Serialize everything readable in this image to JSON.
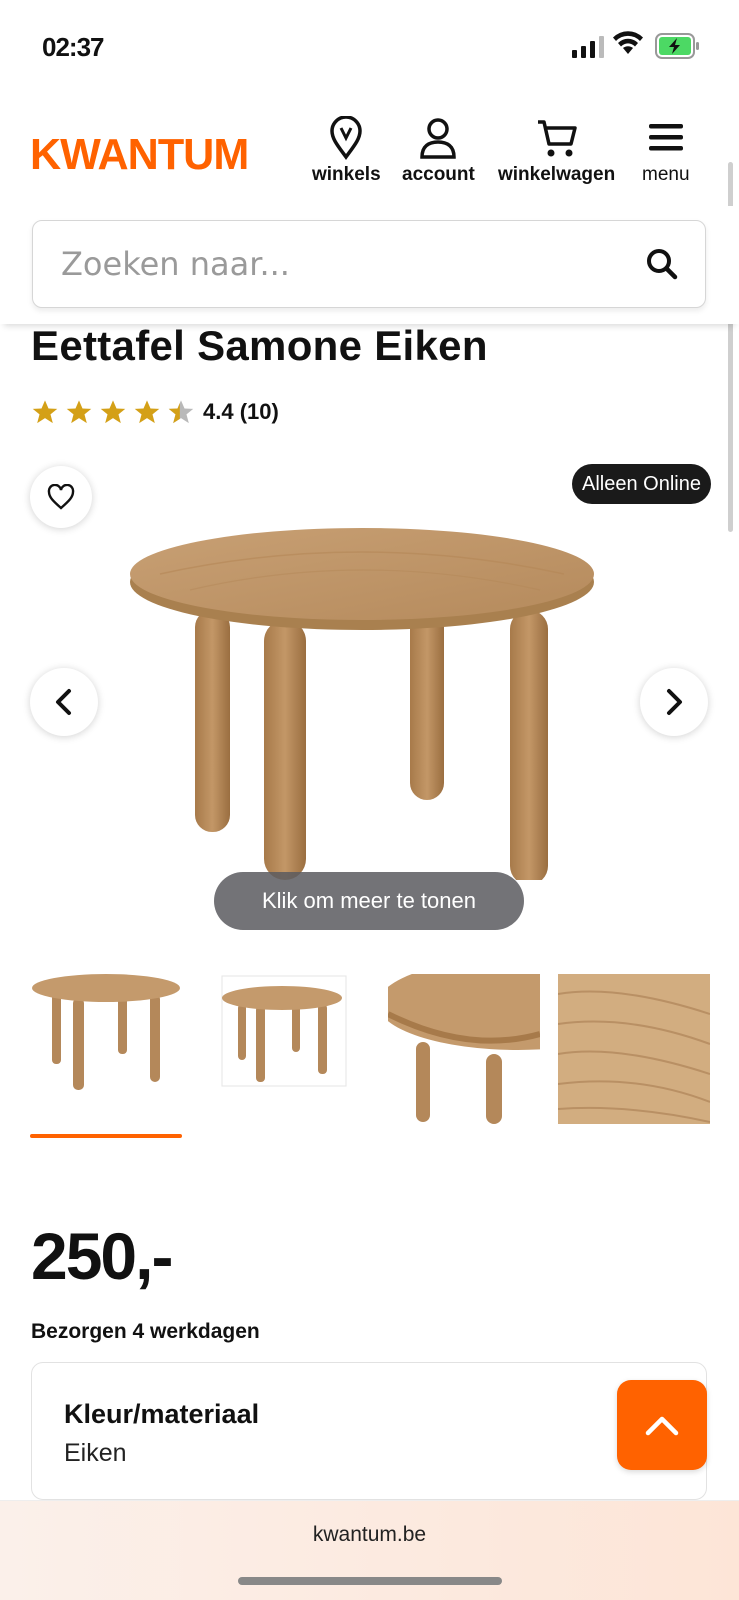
{
  "status_bar": {
    "time": "02:37",
    "signal_icon": "cellular-signal-icon",
    "wifi_icon": "wifi-icon",
    "battery_icon": "battery-charging-icon"
  },
  "header": {
    "logo": "KWANTUM",
    "brand_color": "#ff6200",
    "nav": [
      {
        "label": "winkels",
        "icon": "location-pin-icon"
      },
      {
        "label": "account",
        "icon": "user-icon"
      },
      {
        "label": "winkelwagen",
        "icon": "cart-icon"
      },
      {
        "label": "menu",
        "icon": "hamburger-menu-icon"
      }
    ]
  },
  "search": {
    "placeholder": "Zoeken naar...",
    "value": "",
    "icon": "search-icon"
  },
  "product": {
    "title": "Eettafel Samone Eiken",
    "rating_value": 4.4,
    "rating_text": "4.4 (10)",
    "badge": "Alleen Online",
    "show_more": "Klik om meer te tonen",
    "thumbnail_count": 4,
    "selected_thumbnail": 1,
    "price": "250,-",
    "delivery": "Bezorgen 4 werkdagen",
    "option_label": "Kleur/materiaal",
    "option_value": "Eiken"
  },
  "browser": {
    "url": "kwantum.be"
  }
}
